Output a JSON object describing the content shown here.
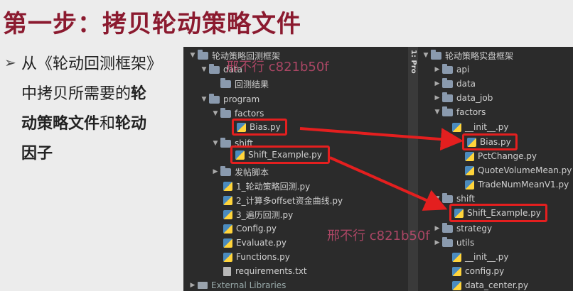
{
  "slide": {
    "title": "第一步：拷贝轮动策略文件",
    "bullet_symbol": "➢",
    "desc": {
      "p1": "从《轮动回测框架》",
      "p2": "中拷贝所需要的",
      "p3": "轮",
      "p4": "动策略文件",
      "p5": "和",
      "p6": "轮动",
      "p7": "因子"
    }
  },
  "left_tree": {
    "root": "轮动策略回测框架",
    "data": "data",
    "result": "回测结果",
    "program": "program",
    "factors": "factors",
    "bias": "Bias.py",
    "shift": "shift",
    "shift_example": "Shift_Example.py",
    "fatie": "发帖脚本",
    "f1": "1_轮动策略回测.py",
    "f2": "2_计算多offset资金曲线.py",
    "f3": "3_遍历回测.py",
    "config": "Config.py",
    "evaluate": "Evaluate.py",
    "functions": "Functions.py",
    "req": "requirements.txt",
    "ext": "External Libraries"
  },
  "side_tab": "1: Pro",
  "right_tree": {
    "root": "轮动策略实盘框架",
    "api": "api",
    "data": "data",
    "data_job": "data_job",
    "factors": "factors",
    "init1": "__init__.py",
    "bias": "Bias.py",
    "pct": "PctChange.py",
    "qvm": "QuoteVolumeMean.py",
    "tnm": "TradeNumMeanV1.py",
    "shift": "shift",
    "shift_example": "Shift_Example.py",
    "strategy": "strategy",
    "utils": "utils",
    "init2": "__init__.py",
    "config": "config.py",
    "data_center": "data_center.py"
  },
  "watermark": {
    "w1": "邢不行 c821b50f",
    "w2": "邢不行 c821b50f"
  },
  "colors": {
    "title": "#8b1a2f",
    "highlight": "#e41f1f",
    "ide_bg": "#2b2b2b"
  }
}
